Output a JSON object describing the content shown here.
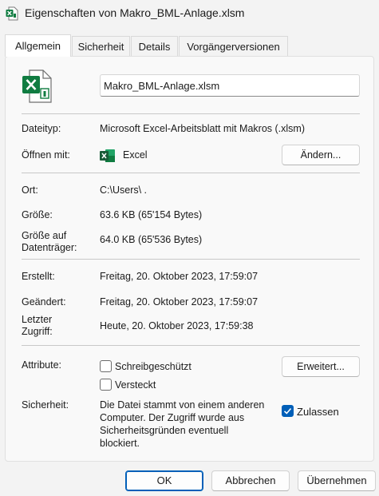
{
  "window": {
    "title": "Eigenschaften von Makro_BML-Anlage.xlsm",
    "icon": "excel-file-icon"
  },
  "tabs": [
    {
      "label": "Allgemein",
      "active": true
    },
    {
      "label": "Sicherheit",
      "active": false
    },
    {
      "label": "Details",
      "active": false
    },
    {
      "label": "Vorgängerversionen",
      "active": false
    }
  ],
  "general": {
    "filename": "Makro_BML-Anlage.xlsm",
    "file_type_label": "Dateityp:",
    "file_type_value": "Microsoft Excel-Arbeitsblatt mit Makros (.xlsm)",
    "open_with_label": "Öffnen mit:",
    "open_with_app": "Excel",
    "change_button": "Ändern...",
    "location_label": "Ort:",
    "location_value": "C:\\Users\\ .",
    "size_label": "Größe:",
    "size_value": "63.6 KB (65'154 Bytes)",
    "size_on_disk_label_1": "Größe auf",
    "size_on_disk_label_2": "Datenträger:",
    "size_on_disk_value": "64.0 KB (65'536 Bytes)",
    "created_label": "Erstellt:",
    "created_value": "Freitag, 20. Oktober 2023, 17:59:07",
    "modified_label": "Geändert:",
    "modified_value": "Freitag, 20. Oktober 2023, 17:59:07",
    "accessed_label_1": "Letzter",
    "accessed_label_2": "Zugriff:",
    "accessed_value": "Heute, 20. Oktober 2023, 17:59:38",
    "attributes_label": "Attribute:",
    "readonly_label": "Schreibgeschützt",
    "readonly_checked": false,
    "hidden_label": "Versteckt",
    "hidden_checked": false,
    "advanced_button": "Erweitert...",
    "security_label": "Sicherheit:",
    "security_text_1": "Die Datei stammt von einem anderen",
    "security_text_2": "Computer. Der Zugriff wurde aus",
    "security_text_3": "Sicherheitsgründen eventuell",
    "security_text_4": "blockiert.",
    "unblock_label": "Zulassen",
    "unblock_checked": true
  },
  "footer": {
    "ok": "OK",
    "cancel": "Abbrechen",
    "apply": "Übernehmen"
  },
  "colors": {
    "accent": "#005fb8",
    "excel_green": "#107c41"
  }
}
